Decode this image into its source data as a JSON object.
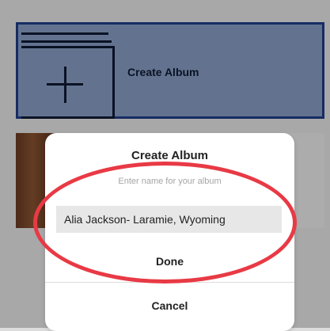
{
  "background": {
    "create_album_label": "Create Album"
  },
  "dialog": {
    "title": "Create Album",
    "hint": "Enter name for your album",
    "input_value": "Alia Jackson- Laramie, Wyoming",
    "done_label": "Done",
    "cancel_label": "Cancel"
  },
  "colors": {
    "create_album_highlight": "#8aa0c6",
    "create_album_border": "#1f3d8a",
    "annotation_red": "#e83a45"
  },
  "icons": {
    "plus": "plus-icon"
  }
}
